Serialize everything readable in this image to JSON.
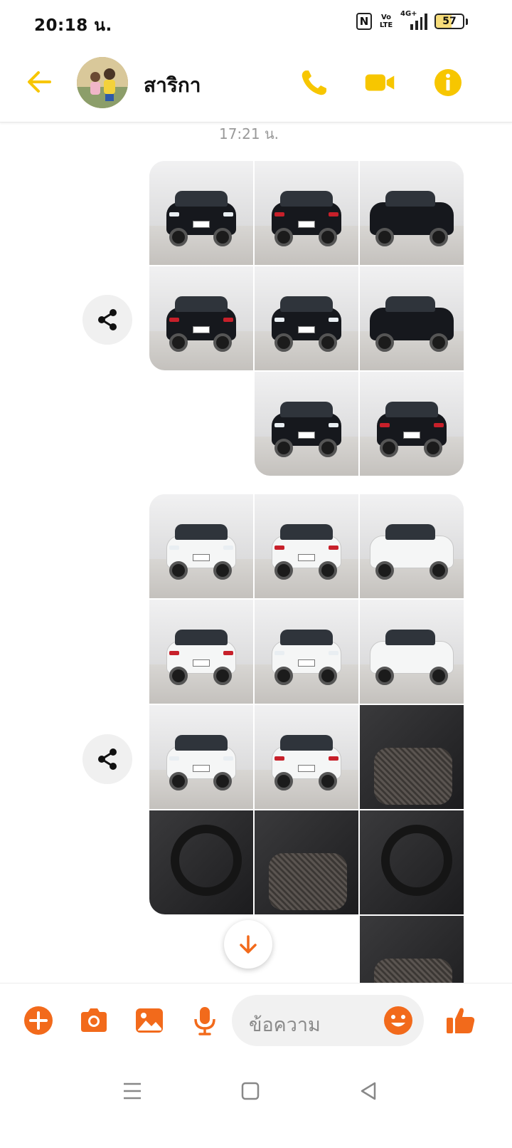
{
  "status_bar": {
    "time": "20:18 น.",
    "nfc": "N",
    "volte": "Vo LTE",
    "network": "4G+",
    "battery": "57",
    "battery_level": 0.57
  },
  "header": {
    "contact_name": "สาริกา",
    "accent_color": "#f7c600"
  },
  "chat": {
    "timestamp": "17:21 น.",
    "albums": [
      {
        "photo_count": 8,
        "car_color": "black"
      },
      {
        "photo_count": 16,
        "car_color": "white"
      }
    ]
  },
  "composer": {
    "placeholder": "ข้อความ",
    "accent_color": "#f26a1b"
  }
}
